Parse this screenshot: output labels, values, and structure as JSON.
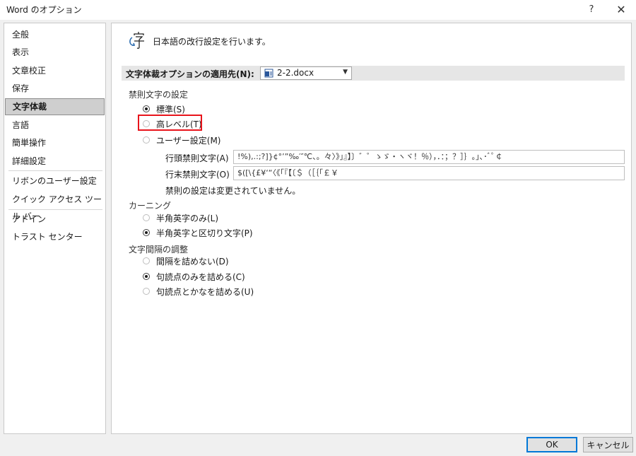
{
  "window": {
    "title": "Word のオプション",
    "help": "?",
    "close": "✕"
  },
  "sidebar": {
    "items": [
      {
        "label": "全般"
      },
      {
        "label": "表示"
      },
      {
        "label": "文章校正"
      },
      {
        "label": "保存"
      },
      {
        "label": "文字体裁",
        "selected": true
      },
      {
        "label": "言語"
      },
      {
        "label": "簡単操作"
      },
      {
        "label": "詳細設定"
      },
      {
        "label": "リボンのユーザー設定"
      },
      {
        "label": "クイック アクセス ツール バー"
      },
      {
        "label": "アドイン"
      },
      {
        "label": "トラスト センター"
      }
    ]
  },
  "header": {
    "text": "日本語の改行設定を行います。"
  },
  "apply": {
    "label": "文字体裁オプションの適用先(N):",
    "document": "2-2.docx"
  },
  "kinsoku": {
    "title": "禁則文字の設定",
    "options": [
      {
        "label": "標準(S)",
        "checked": true
      },
      {
        "label": "高レベル(T)",
        "checked": false
      },
      {
        "label": "ユーザー設定(M)",
        "checked": false
      }
    ],
    "leading_label": "行頭禁則文字(A)",
    "leading_value": "!%),.:;?]}¢°’”‰′″℃、。々〉》」』】〕゛゜ゝゞ・ヽヾ！％），．：；？］｝｡｣､･ﾞﾟ￠",
    "trailing_label": "行末禁則文字(O)",
    "trailing_value": "$([\\{£¥‘“〈《「『【〔＄（［｛｢￡￥",
    "note": "禁則の設定は変更されていません。"
  },
  "kerning": {
    "title": "カーニング",
    "options": [
      {
        "label": "半角英字のみ(L)",
        "checked": false
      },
      {
        "label": "半角英字と区切り文字(P)",
        "checked": true
      }
    ]
  },
  "spacing": {
    "title": "文字間隔の調整",
    "options": [
      {
        "label": "間隔を詰めない(D)",
        "checked": false
      },
      {
        "label": "句読点のみを詰める(C)",
        "checked": true
      },
      {
        "label": "句読点とかなを詰める(U)",
        "checked": false
      }
    ]
  },
  "buttons": {
    "ok": "OK",
    "cancel": "キャンセル"
  },
  "colors": {
    "highlight": "#e8141b",
    "accent": "#0078d7",
    "selected_bg": "#cfcfcf"
  }
}
